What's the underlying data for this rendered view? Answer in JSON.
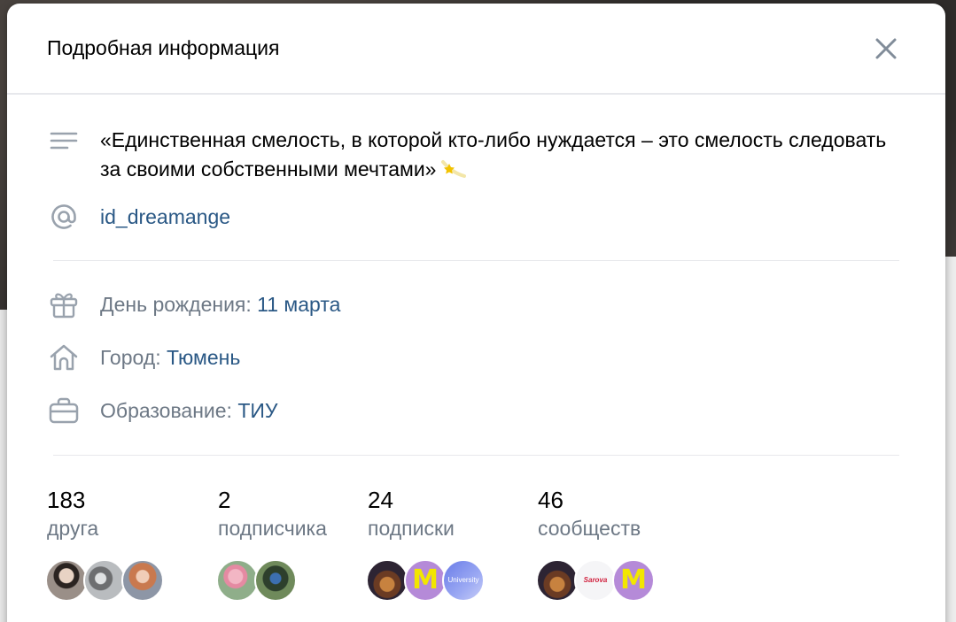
{
  "modal": {
    "title": "Подробная информация"
  },
  "profile": {
    "status": "«Единственная смелость, в которой кто-либо нуждается – это смелость следовать за своими собственными мечтами»",
    "username": "id_dreamange",
    "birthday_label": "День рождения: ",
    "birthday_value": "11 марта",
    "city_label": "Город: ",
    "city_value": "Тюмень",
    "education_label": "Образование: ",
    "education_value": "ТИУ"
  },
  "stats": [
    {
      "count": "183",
      "label": "друга"
    },
    {
      "count": "2",
      "label": "подписчика"
    },
    {
      "count": "24",
      "label": "подписки"
    },
    {
      "count": "46",
      "label": "сообществ"
    }
  ],
  "colors": {
    "link": "#2a5885",
    "secondary": "#6d7885",
    "icon": "#99a2ad"
  }
}
